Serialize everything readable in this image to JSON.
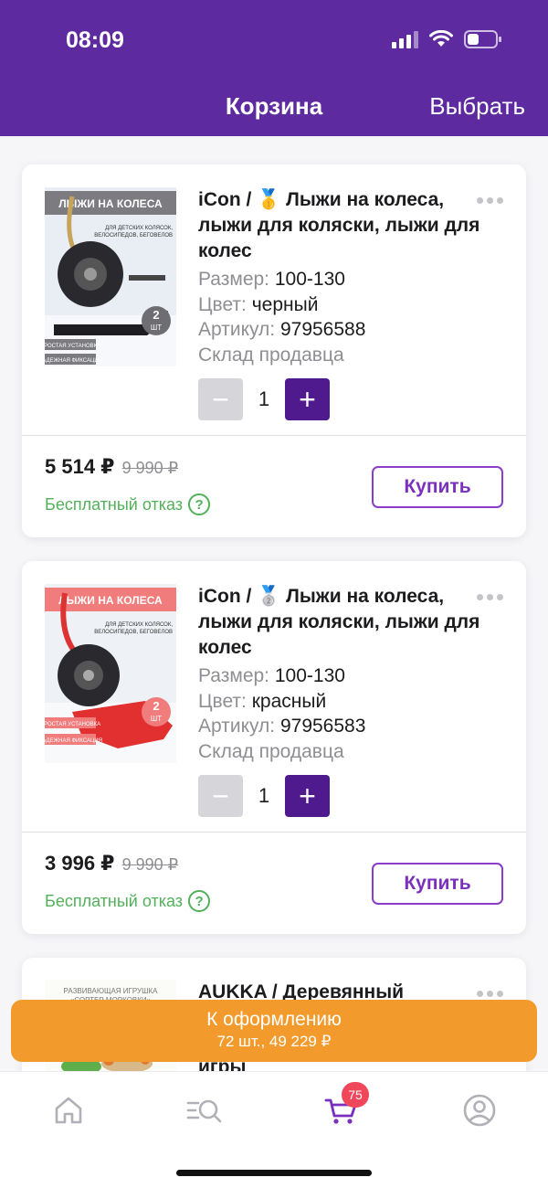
{
  "status_bar": {
    "time": "08:09"
  },
  "header": {
    "title": "Корзина",
    "action": "Выбрать"
  },
  "cart_items": [
    {
      "brand_title": "iCon / 🥇 Лыжи на колеса, лыжи для коляски, лыжи для колес",
      "image_text": {
        "heading": "ЛЫЖИ НА КОЛЕСА",
        "sub": "ДЛЯ ДЕТСКИХ КОЛЯСОК, ВЕЛОСИПЕДОВ, БЕГОВЕЛОВ",
        "count": "2 шт",
        "tag1": "ПРОСТАЯ УСТАНОВКА",
        "tag2": "НАДЕЖНАЯ ФИКСАЦИЯ"
      },
      "size_label": "Размер:",
      "size_value": "100-130",
      "color_label": "Цвет:",
      "color_value": "черный",
      "article_label": "Артикул:",
      "article_value": "97956588",
      "warehouse": "Склад продавца",
      "quantity": "1",
      "price": "5 514 ₽",
      "old_price": "9 990 ₽",
      "free_refusal": "Бесплатный отказ",
      "buy_label": "Купить"
    },
    {
      "brand_title": "iCon / 🥈 Лыжи на колеса, лыжи для коляски, лыжи для колес",
      "image_text": {
        "heading": "ЛЫЖИ НА КОЛЕСА",
        "sub": "ДЛЯ ДЕТСКИХ КОЛЯСОК, ВЕЛОСИПЕДОВ, БЕГОВЕЛОВ",
        "count": "2 шт",
        "tag1": "ПРОСТАЯ УСТАНОВКА",
        "tag2": "НАДЕЖНАЯ ФИКСАЦИЯ"
      },
      "size_label": "Размер:",
      "size_value": "100-130",
      "color_label": "Цвет:",
      "color_value": "красный",
      "article_label": "Артикул:",
      "article_value": "97956583",
      "warehouse": "Склад продавца",
      "quantity": "1",
      "price": "3 996 ₽",
      "old_price": "9 990 ₽",
      "free_refusal": "Бесплатный отказ",
      "buy_label": "Купить"
    },
    {
      "brand_title": "AUKKA / Деревянный",
      "title_cont": "игры",
      "image_text": {
        "heading": "РАЗВИВАЮЩАЯ ИГРУШКА",
        "sub": "«СОРТЕР МОРКОВКИ»"
      }
    }
  ],
  "checkout": {
    "label": "К оформлению",
    "summary": "72 шт., 49 229 ₽"
  },
  "tabbar": {
    "cart_badge": "75"
  },
  "colors": {
    "header": "#5e2a9f",
    "accent": "#4f1a8e",
    "checkout": "#f29b2c",
    "badge": "#f0475a",
    "green": "#52b05a"
  }
}
